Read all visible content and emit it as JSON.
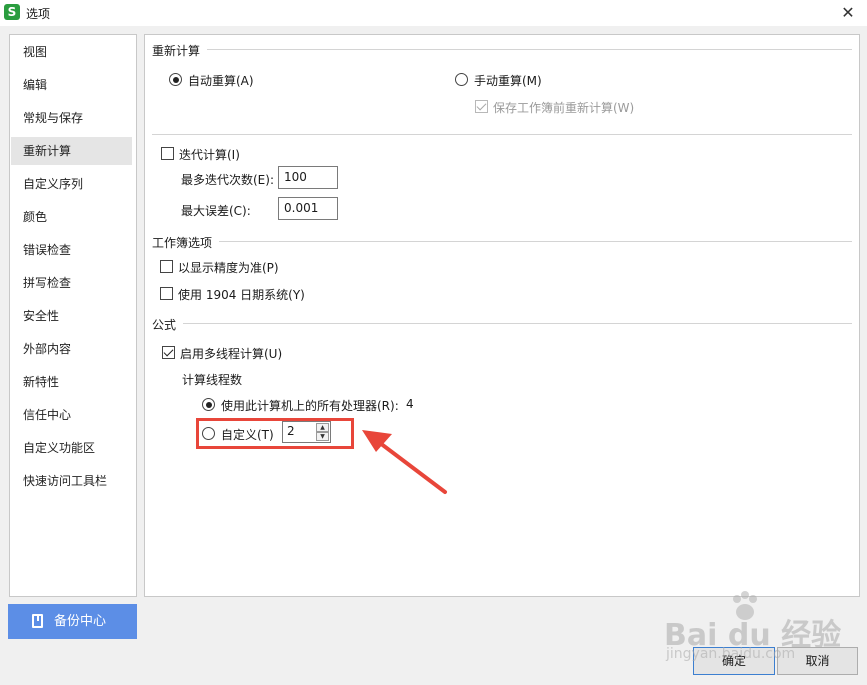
{
  "window": {
    "title": "选项",
    "app_icon": "S",
    "close_glyph": "✕"
  },
  "sidebar": {
    "items": [
      {
        "label": "视图"
      },
      {
        "label": "编辑"
      },
      {
        "label": "常规与保存"
      },
      {
        "label": "重新计算",
        "active": true
      },
      {
        "label": "自定义序列"
      },
      {
        "label": "颜色"
      },
      {
        "label": "错误检查"
      },
      {
        "label": "拼写检查"
      },
      {
        "label": "安全性"
      },
      {
        "label": "外部内容"
      },
      {
        "label": "新特性"
      },
      {
        "label": "信任中心"
      },
      {
        "label": "自定义功能区"
      },
      {
        "label": "快速访问工具栏"
      }
    ],
    "backup_label": "备份中心"
  },
  "recalc": {
    "section_title": "重新计算",
    "auto_label": "自动重算(A)",
    "manual_label": "手动重算(M)",
    "save_recalc_label": "保存工作簿前重新计算(W)",
    "iterate_label": "迭代计算(I)",
    "max_iter_label": "最多迭代次数(E):",
    "max_iter_value": "100",
    "max_change_label": "最大误差(C):",
    "max_change_value": "0.001"
  },
  "workbook": {
    "section_title": "工作簿选项",
    "precision_label": "以显示精度为准(P)",
    "date1904_label": "使用 1904 日期系统(Y)"
  },
  "formula": {
    "section_title": "公式",
    "multithread_label": "启用多线程计算(U)",
    "threads_title": "计算线程数",
    "use_all_label": "使用此计算机上的所有处理器(R):",
    "processor_count": "4",
    "custom_label": "自定义(T)",
    "custom_value": "2"
  },
  "buttons": {
    "ok": "确定",
    "cancel": "取消"
  },
  "watermark": {
    "main": "Bai du 经验",
    "sub": "jingyan.baidu.com"
  },
  "colors": {
    "accent": "#5c8ee6",
    "highlight": "#e8463a",
    "arrow": "#e8463a"
  }
}
